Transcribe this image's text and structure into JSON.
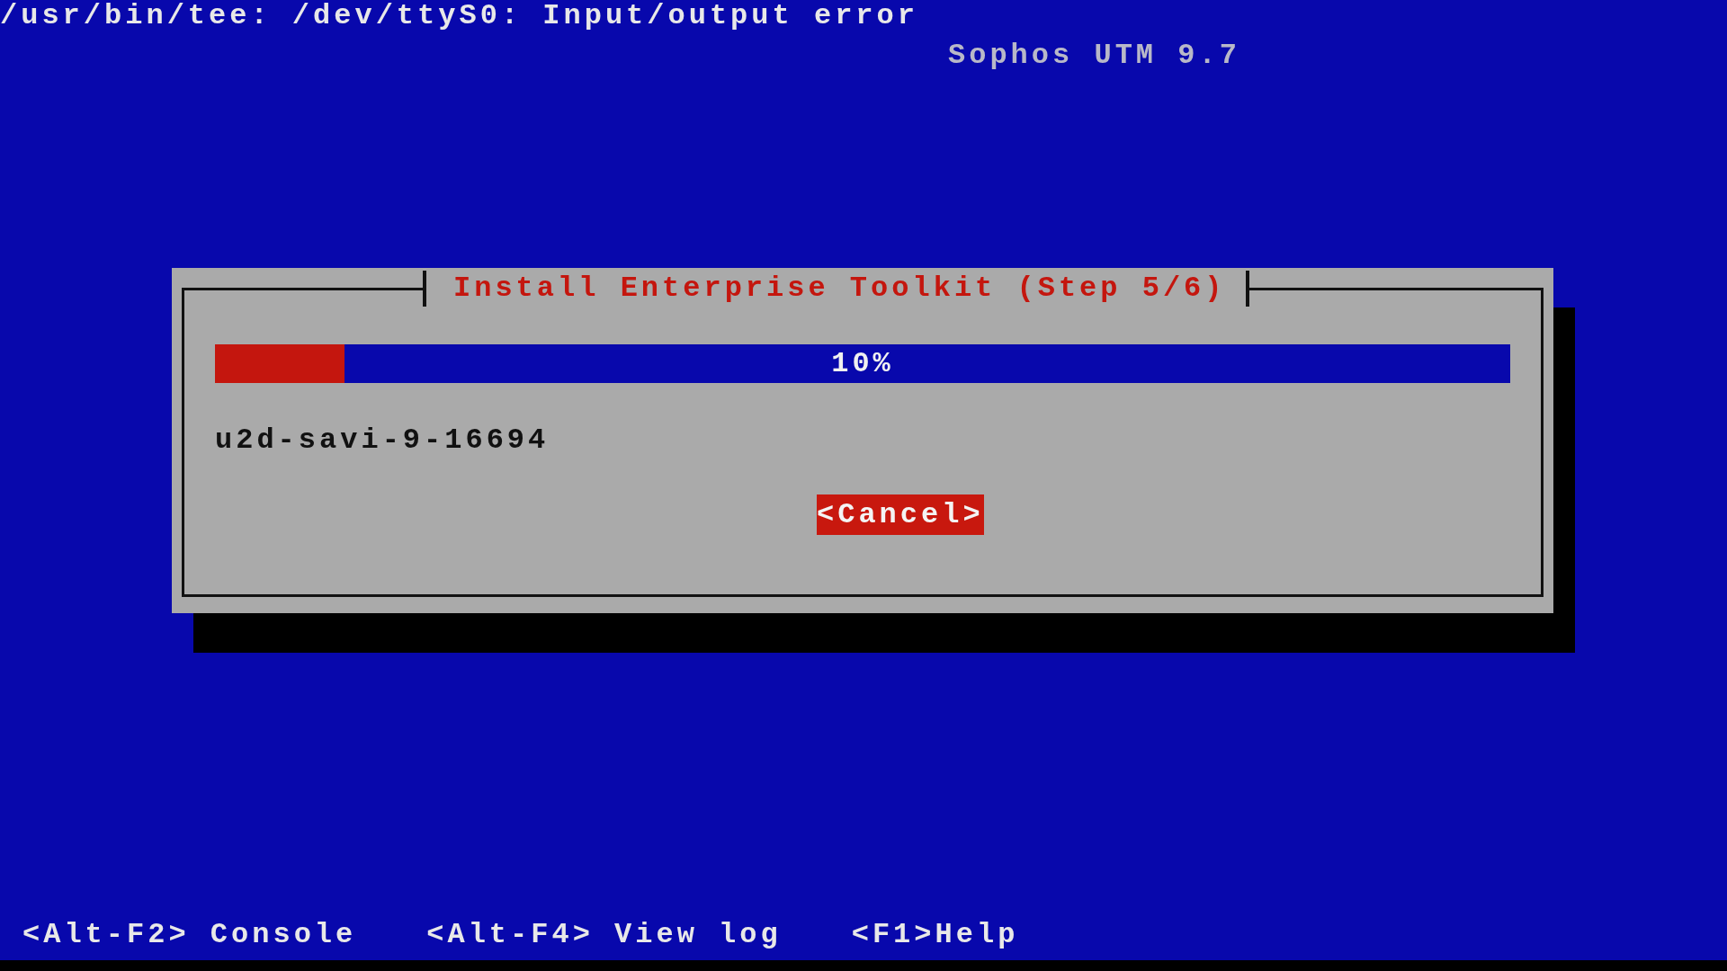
{
  "console_message": "/usr/bin/tee: /dev/ttyS0: Input/output error",
  "product": "Sophos UTM 9.7",
  "dialog": {
    "title": "Install Enterprise Toolkit (Step 5/6)",
    "progress": {
      "level": 0.1,
      "reading": "10%"
    },
    "package": "u2d-savi-9-16694",
    "buttons": [
      {
        "label": "<Cancel>",
        "selected": true
      }
    ]
  },
  "hints": [
    "<Alt-F2> Console",
    "<Alt-F4> View log",
    "<F1>Help"
  ]
}
